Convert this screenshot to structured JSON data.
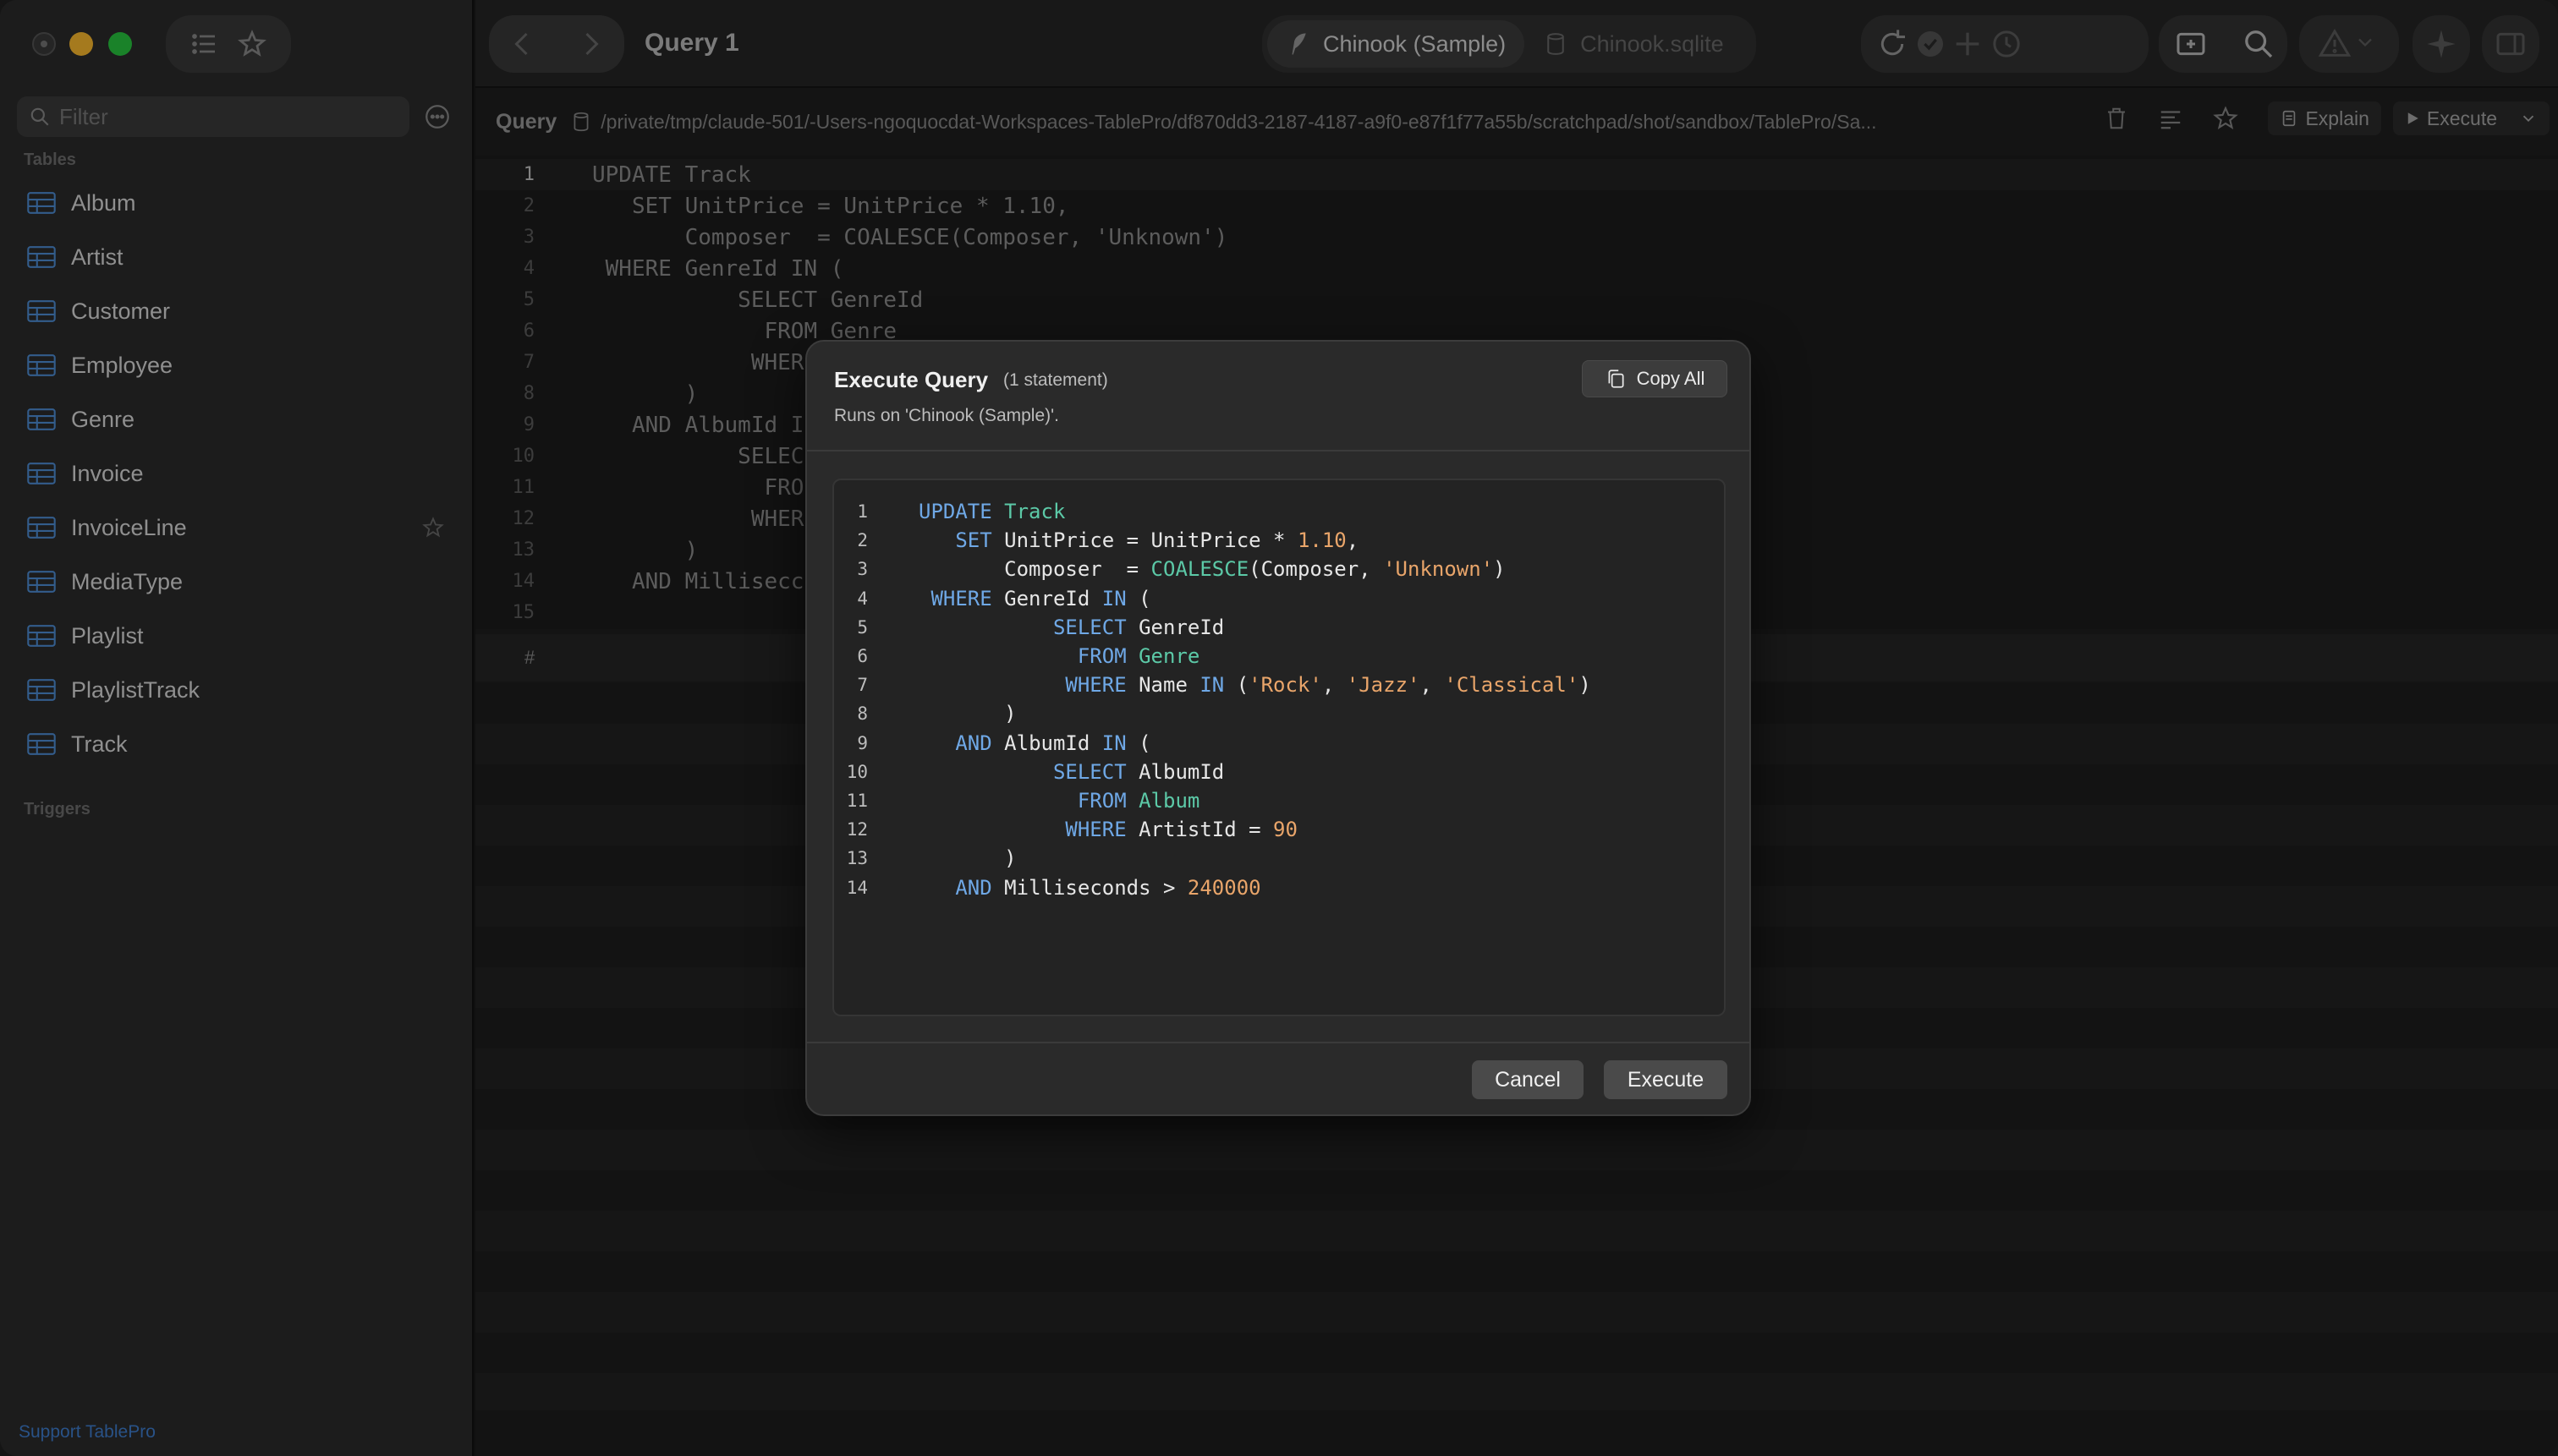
{
  "window": {
    "title": "Query 1"
  },
  "sidebar": {
    "filter_placeholder": "Filter",
    "tables_header": "Tables",
    "triggers_header": "Triggers",
    "tables": [
      {
        "label": "Album"
      },
      {
        "label": "Artist"
      },
      {
        "label": "Customer"
      },
      {
        "label": "Employee"
      },
      {
        "label": "Genre"
      },
      {
        "label": "Invoice"
      },
      {
        "label": "InvoiceLine"
      },
      {
        "label": "MediaType"
      },
      {
        "label": "Playlist"
      },
      {
        "label": "PlaylistTrack"
      },
      {
        "label": "Track"
      }
    ],
    "support_link": "Support TablePro"
  },
  "toolbar": {
    "connection_name": "Chinook (Sample)",
    "database_file": "Chinook.sqlite",
    "icons": [
      "refresh-icon",
      "commit-icon",
      "add-icon",
      "history-icon",
      "new-tab-icon",
      "search-icon",
      "warning-icon",
      "ai-sparkle-icon",
      "sidebar-toggle-icon"
    ]
  },
  "path_bar": {
    "label": "Query",
    "path": "/private/tmp/claude-501/-Users-ngoquocdat-Workspaces-TablePro/df870dd3-2187-4187-a9f0-e87f1f77a55b/scratchpad/shot/sandbox/TablePro/Sa...",
    "explain_label": "Explain",
    "execute_label": "Execute"
  },
  "editor": {
    "line_numbers": [
      "1",
      "2",
      "3",
      "4",
      "5",
      "6",
      "7",
      "8",
      "9",
      "10",
      "11",
      "12",
      "13",
      "14",
      "15"
    ],
    "visible_lines": [
      "UPDATE Track",
      "   SET UnitPrice = UnitPrice * 1.10,",
      "       Composer  = COALESCE(Composer, 'Unknown')",
      " WHERE GenreId IN (",
      "           SELECT GenreId",
      "             FROM Genre",
      "            WHER",
      "       )",
      "   AND AlbumId I",
      "           SELEC",
      "             FRO",
      "            WHER",
      "       )",
      "   AND Millisecc",
      ""
    ],
    "results_header": "#"
  },
  "modal": {
    "title": "Execute Query",
    "statement_count": "(1 statement)",
    "subtitle": "Runs on 'Chinook (Sample)'.",
    "copy_all_label": "Copy All",
    "cancel_label": "Cancel",
    "execute_label": "Execute",
    "code_lines": [
      {
        "n": "1",
        "segs": [
          [
            "kw",
            "UPDATE"
          ],
          [
            "t",
            " "
          ],
          [
            "tbl",
            "Track"
          ]
        ]
      },
      {
        "n": "2",
        "segs": [
          [
            "t",
            "   "
          ],
          [
            "kw",
            "SET"
          ],
          [
            "t",
            " UnitPrice = UnitPrice * "
          ],
          [
            "num",
            "1.10"
          ],
          [
            "t",
            ","
          ]
        ]
      },
      {
        "n": "3",
        "segs": [
          [
            "t",
            "       Composer  = "
          ],
          [
            "fn",
            "COALESCE"
          ],
          [
            "t",
            "(Composer, "
          ],
          [
            "str",
            "'Unknown'"
          ],
          [
            "t",
            ")"
          ]
        ]
      },
      {
        "n": "4",
        "segs": [
          [
            "t",
            " "
          ],
          [
            "kw",
            "WHERE"
          ],
          [
            "t",
            " GenreId "
          ],
          [
            "kw",
            "IN"
          ],
          [
            "t",
            " ("
          ]
        ]
      },
      {
        "n": "5",
        "segs": [
          [
            "t",
            "           "
          ],
          [
            "kw",
            "SELECT"
          ],
          [
            "t",
            " GenreId"
          ]
        ]
      },
      {
        "n": "6",
        "segs": [
          [
            "t",
            "             "
          ],
          [
            "kw",
            "FROM"
          ],
          [
            "t",
            " "
          ],
          [
            "tbl",
            "Genre"
          ]
        ]
      },
      {
        "n": "7",
        "segs": [
          [
            "t",
            "            "
          ],
          [
            "kw",
            "WHERE"
          ],
          [
            "t",
            " Name "
          ],
          [
            "kw",
            "IN"
          ],
          [
            "t",
            " ("
          ],
          [
            "str",
            "'Rock'"
          ],
          [
            "t",
            ", "
          ],
          [
            "str",
            "'Jazz'"
          ],
          [
            "t",
            ", "
          ],
          [
            "str",
            "'Classical'"
          ],
          [
            "t",
            ")"
          ]
        ]
      },
      {
        "n": "8",
        "segs": [
          [
            "t",
            "       )"
          ]
        ]
      },
      {
        "n": "9",
        "segs": [
          [
            "t",
            "   "
          ],
          [
            "kw",
            "AND"
          ],
          [
            "t",
            " AlbumId "
          ],
          [
            "kw",
            "IN"
          ],
          [
            "t",
            " ("
          ]
        ]
      },
      {
        "n": "10",
        "segs": [
          [
            "t",
            "           "
          ],
          [
            "kw",
            "SELECT"
          ],
          [
            "t",
            " AlbumId"
          ]
        ]
      },
      {
        "n": "11",
        "segs": [
          [
            "t",
            "             "
          ],
          [
            "kw",
            "FROM"
          ],
          [
            "t",
            " "
          ],
          [
            "tbl",
            "Album"
          ]
        ]
      },
      {
        "n": "12",
        "segs": [
          [
            "t",
            "            "
          ],
          [
            "kw",
            "WHERE"
          ],
          [
            "t",
            " ArtistId = "
          ],
          [
            "num",
            "90"
          ]
        ]
      },
      {
        "n": "13",
        "segs": [
          [
            "t",
            "       )"
          ]
        ]
      },
      {
        "n": "14",
        "segs": [
          [
            "t",
            "   "
          ],
          [
            "kw",
            "AND"
          ],
          [
            "t",
            " Milliseconds > "
          ],
          [
            "num",
            "240000"
          ]
        ]
      }
    ]
  },
  "colors": {
    "keyword": "#6fa8e6",
    "identifier_table": "#5cc9a7",
    "string_number": "#e9a56a",
    "traffic_minimize": "#febc2e",
    "traffic_maximize": "#28c840",
    "link": "#3f7fd0"
  }
}
